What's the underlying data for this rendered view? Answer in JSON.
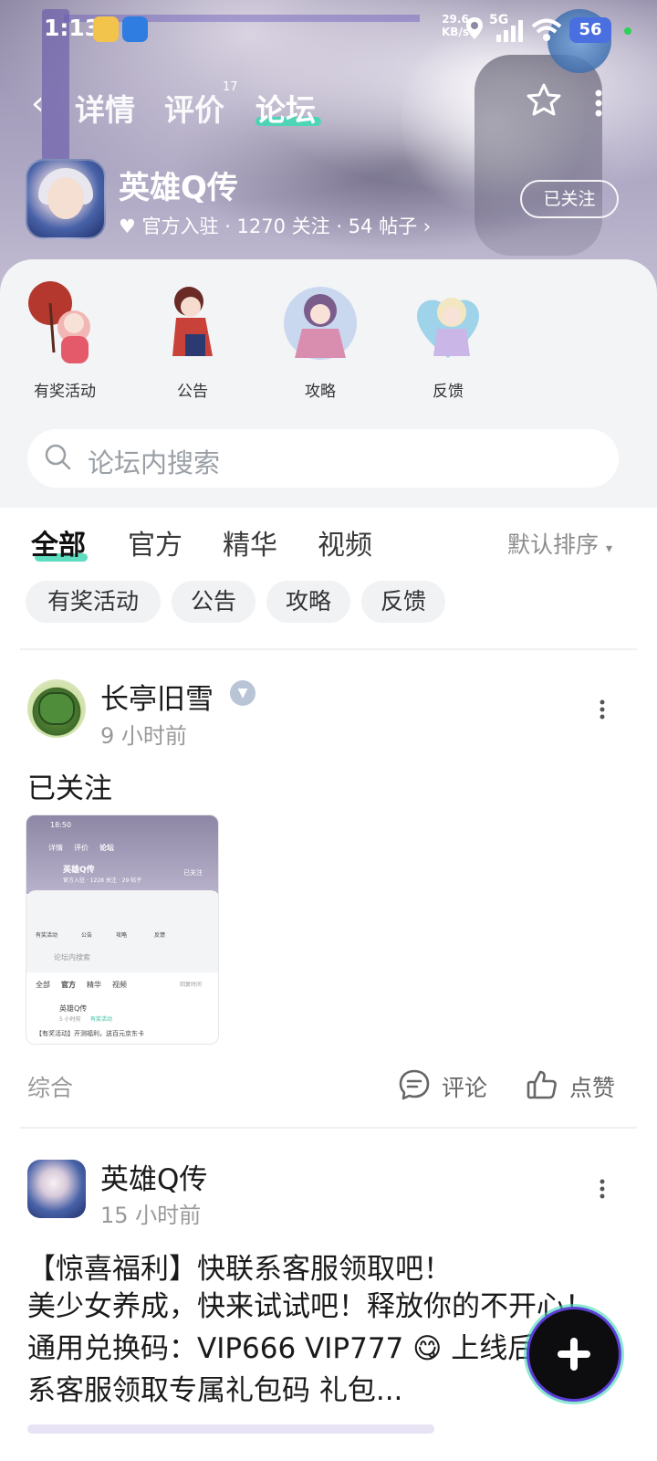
{
  "status_bar": {
    "time": "1:13",
    "net_speed_value": "29.6",
    "net_speed_unit": "KB/s",
    "signal_label": "5G",
    "battery": "56"
  },
  "nav": {
    "tabs": [
      {
        "label": "详情"
      },
      {
        "label": "评价",
        "count": "17"
      },
      {
        "label": "论坛"
      }
    ]
  },
  "game": {
    "title": "英雄Q传",
    "meta": "官方入驻 · 1270 关注 · 54 帖子",
    "follow_label": "已关注"
  },
  "categories": [
    {
      "label": "有奖活动"
    },
    {
      "label": "公告"
    },
    {
      "label": "攻略"
    },
    {
      "label": "反馈"
    }
  ],
  "search": {
    "placeholder": "论坛内搜索"
  },
  "filter_tabs": [
    {
      "label": "全部"
    },
    {
      "label": "官方"
    },
    {
      "label": "精华"
    },
    {
      "label": "视频"
    }
  ],
  "sort_label": "默认排序",
  "chips": [
    {
      "label": "有奖活动"
    },
    {
      "label": "公告"
    },
    {
      "label": "攻略"
    },
    {
      "label": "反馈"
    }
  ],
  "posts": [
    {
      "author": "长亭旧雪",
      "time": "9 小时前",
      "text": "已关注",
      "category": "综合",
      "comment_label": "评论",
      "like_label": "点赞",
      "thumbnail": {
        "time": "18:50",
        "tabs": [
          "详情",
          "评价",
          "论坛"
        ],
        "title": "英雄Q传",
        "meta": "官方入驻 · 1228 关注 · 29 帖子",
        "follow": "已关注",
        "cats": [
          "有奖活动",
          "公告",
          "攻略",
          "反馈"
        ],
        "search": "论坛内搜索",
        "filters": [
          "全部",
          "官方",
          "精华",
          "视频"
        ],
        "sort": "回复时间",
        "post_author": "英雄Q传",
        "post_time": "5 小时前",
        "post_tag": "有奖活动",
        "post_title": "【有奖活动】开测福利，送百元京东卡"
      }
    },
    {
      "author": "英雄Q传",
      "time": "15 小时前",
      "title": "【惊喜福利】快联系客服领取吧！",
      "body": "美少女养成，快来试试吧！释放你的不开心！通用兑换码：VIP666 VIP777 😋 上线后可联系客服领取专属礼包码 礼包..."
    }
  ],
  "colors": {
    "accent": "#43d7b5",
    "banner": "#a49dbb",
    "chip_bg": "#f1f2f4",
    "card_bg": "#f3f4f6"
  }
}
